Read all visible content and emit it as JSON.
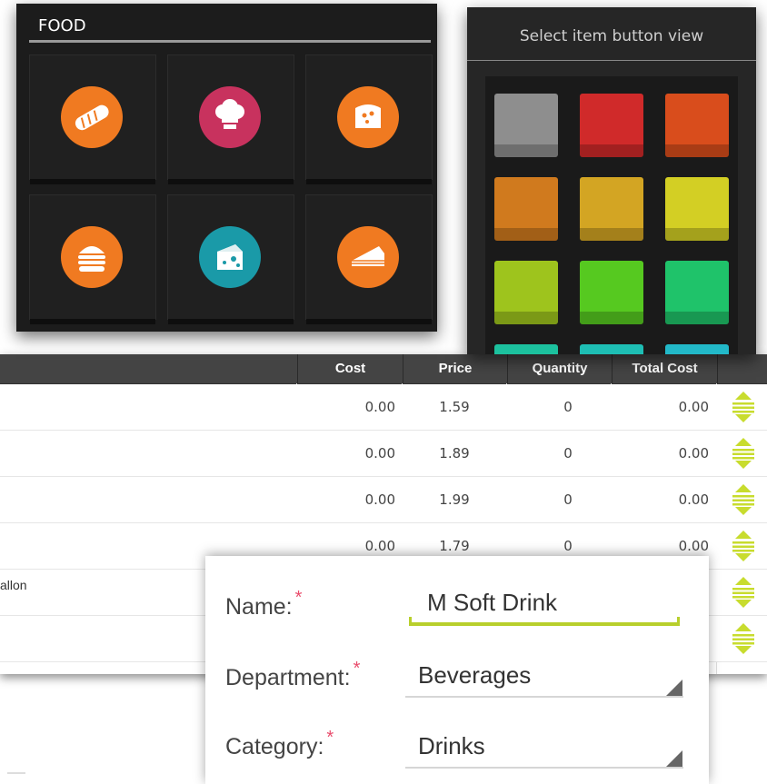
{
  "food_panel": {
    "title": "FOOD",
    "tiles": [
      {
        "icon": "bread-icon",
        "color": "#f07a21"
      },
      {
        "icon": "chef-hat-icon",
        "color": "#c8325e"
      },
      {
        "icon": "cheese-slice-icon",
        "color": "#f07a21"
      },
      {
        "icon": "burger-icon",
        "color": "#f07a21"
      },
      {
        "icon": "cheese-block-icon",
        "color": "#1a9aa8"
      },
      {
        "icon": "cake-slice-icon",
        "color": "#f07a21"
      }
    ]
  },
  "color_panel": {
    "title": "Select item button view",
    "swatches": [
      "#8e8e8e",
      "#d02a2a",
      "#d94d1c",
      "#d07a1e",
      "#d3a523",
      "#d3cf24",
      "#9ec41d",
      "#56c920",
      "#1fc36a",
      "#1cc19e",
      "#1ebeb4",
      "#22b8c8"
    ]
  },
  "table": {
    "headers": [
      "Cost",
      "Price",
      "Quantity",
      "Total Cost"
    ],
    "rows": [
      {
        "name": "",
        "cost": "0.00",
        "price": "1.59",
        "quantity": "0",
        "total": "0.00"
      },
      {
        "name": "",
        "cost": "0.00",
        "price": "1.89",
        "quantity": "0",
        "total": "0.00"
      },
      {
        "name": "",
        "cost": "0.00",
        "price": "1.99",
        "quantity": "0",
        "total": "0.00"
      },
      {
        "name": "",
        "cost": "0.00",
        "price": "1.79",
        "quantity": "0",
        "total": "0.00"
      },
      {
        "name": "allon",
        "cost": "",
        "price": "",
        "quantity": "",
        "total": ""
      },
      {
        "name": "",
        "cost": "",
        "price": "",
        "quantity": "",
        "total": ""
      }
    ],
    "sort_icon_color": "#c8dc2e"
  },
  "form": {
    "name_label": "Name:",
    "name_value": "M Soft Drink",
    "department_label": "Department:",
    "department_value": "Beverages",
    "category_label": "Category:",
    "category_value": "Drinks",
    "required_mark": "*",
    "accent_color": "#b8cf2c"
  }
}
